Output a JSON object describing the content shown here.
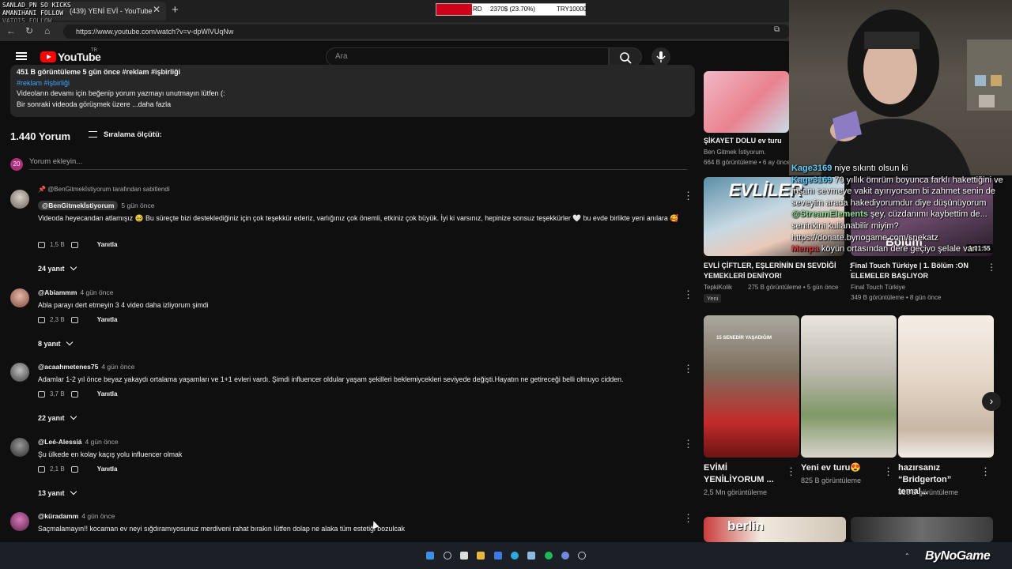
{
  "browser": {
    "tab_title": "(439) YENİ EVİ - YouTube",
    "url": "https://www.youtube.com/watch?v=v-dpWlVUqNw"
  },
  "stream_overlay": {
    "line1": "SANLAD_PN SO KICKS",
    "line2": "AMANIHANI FOLLOW",
    "line3": "VATO15 FOLLOW",
    "donation_label": "RD",
    "donation_progress": "2370$ (23.70%)",
    "donation_goal": "TRY10000",
    "donation_fraction": 0.237
  },
  "header": {
    "logo_text": "YouTube",
    "country": "TR",
    "search_placeholder": "Ara"
  },
  "description": {
    "meta": "451 B görüntüleme  5 gün önce  #reklam #işbirliği",
    "tags": "#reklam #işbirliği",
    "line1": "Videoların devamı için beğenip yorum yazmayı unutmayın lütfen (:",
    "line2": "Bir sonraki videoda görüşmek üzere ...daha fazla"
  },
  "comments_header": {
    "count": "1.440 Yorum",
    "sort": "Sıralama ölçütü:",
    "my_avatar_letter": "20",
    "add_placeholder": "Yorum ekleyin..."
  },
  "comments": [
    {
      "pinned": "@BenGitmekİstiyorum tarafından sabitlendi",
      "author": "@BenGitmekİstiyorum",
      "time": "5 gün önce",
      "text": "Videoda heyecandan atlamışız 🥹 Bu süreçte bizi desteklediğiniz için çok teşekkür ederiz, varlığınız çok önemli, etkiniz çok büyük. İyi ki varsınız, hepinize sonsuz teşekkürler 🤍 bu evde birlikte yeni anılara 🥰",
      "likes": "1,5 B",
      "reply": "Yanıtla",
      "replies": "24 yanıt"
    },
    {
      "author": "@Abiammm",
      "time": "4 gün önce",
      "text": "Abla parayı dert etmeyin 3 4 video daha izliyorum şimdi",
      "likes": "2,3 B",
      "reply": "Yanıtla",
      "replies": "8 yanıt"
    },
    {
      "author": "@acaahmetenes75",
      "time": "4 gün önce",
      "text": "Adamlar 1-2 yıl önce beyaz yakaydı   ortalama yaşamları ve 1+1 evleri vardı. Şimdi influencer oldular yaşam şekilleri beklemiycekleri seviyede değişti.Hayatın ne getireceği belli olmuyo cidden.",
      "likes": "3,7 B",
      "reply": "Yanıtla",
      "replies": "22 yanıt"
    },
    {
      "author": "@Leé-Alessiá",
      "time": "4 gün önce",
      "text": "Şu ülkede en kolay kaçış yolu influencer olmak",
      "likes": "2,1 B",
      "reply": "Yanıtla",
      "replies": "13 yanıt"
    },
    {
      "author": "@küradamm",
      "time": "4 gün önce",
      "text": "Saçmalamayın!! kocaman ev neyi sığdıramıyosunuz merdiveni rahat bırakın lütfen dolap ne alaka tüm estetiği bozulcak"
    }
  ],
  "sidebar": {
    "v1": {
      "title": "ŞİKAYET DOLU ev turu",
      "channel": "Ben Gitmek İstiyorum.",
      "meta": "664 B görüntüleme • 6 ay önce"
    },
    "v2": {
      "thumb_text": "EVLİLER",
      "title": "EVLİ ÇİFTLER, EŞLERİNİN EN SEVDİĞİ YEMEKLERİ DENİYOR!",
      "channel": "TepkiKolik",
      "meta": "275 B görüntüleme • 5 gün önce",
      "badge": "Yeni"
    },
    "v3": {
      "title": "Final Touch Türkiye | 1. Bölüm :ON ELEMELER BAŞLIYOR",
      "channel": "Final Touch Türkiye",
      "meta": "349 B görüntüleme • 8 gün önce",
      "duration": "1:01:55",
      "thumb_text": "Bölüm"
    },
    "shorts": [
      {
        "title": "EVİMİ YENİLİYORUM ...",
        "views": "2,5 Mn görüntüleme",
        "thumb_text": "15 SENEDİR YAŞADIĞIM"
      },
      {
        "title": "Yeni ev turu😍",
        "views": "825 B görüntüleme"
      },
      {
        "title": "hazırsanız “Bridgerton” temal...",
        "views": "816 B görüntüleme"
      }
    ],
    "bottom_thumb_text": "berlin"
  },
  "chat": [
    {
      "user": "Kage3169",
      "msg": " niye sıkıntı olsun ki"
    },
    {
      "user": "Kage3169",
      "msg": " 70 yıllık ömrüm boyunca farklı hakettiğini ve insanı sevmeye vakit ayırıyorsam bi zahmet senin de seveyim arada hakediyorumdur diye düşünüyorum"
    },
    {
      "user": "@StreamElements",
      "msg": " şey, cüzdanımı kaybettim de... seninkini kullanabilir miyim? https://donate.bynogame.com/snekatz"
    },
    {
      "user": "Menpa",
      "msg": " köyün ortasından dere geçiyo şelale varı"
    }
  ],
  "brand": "ByNoGame",
  "tray": {
    "lang": "TUR"
  }
}
